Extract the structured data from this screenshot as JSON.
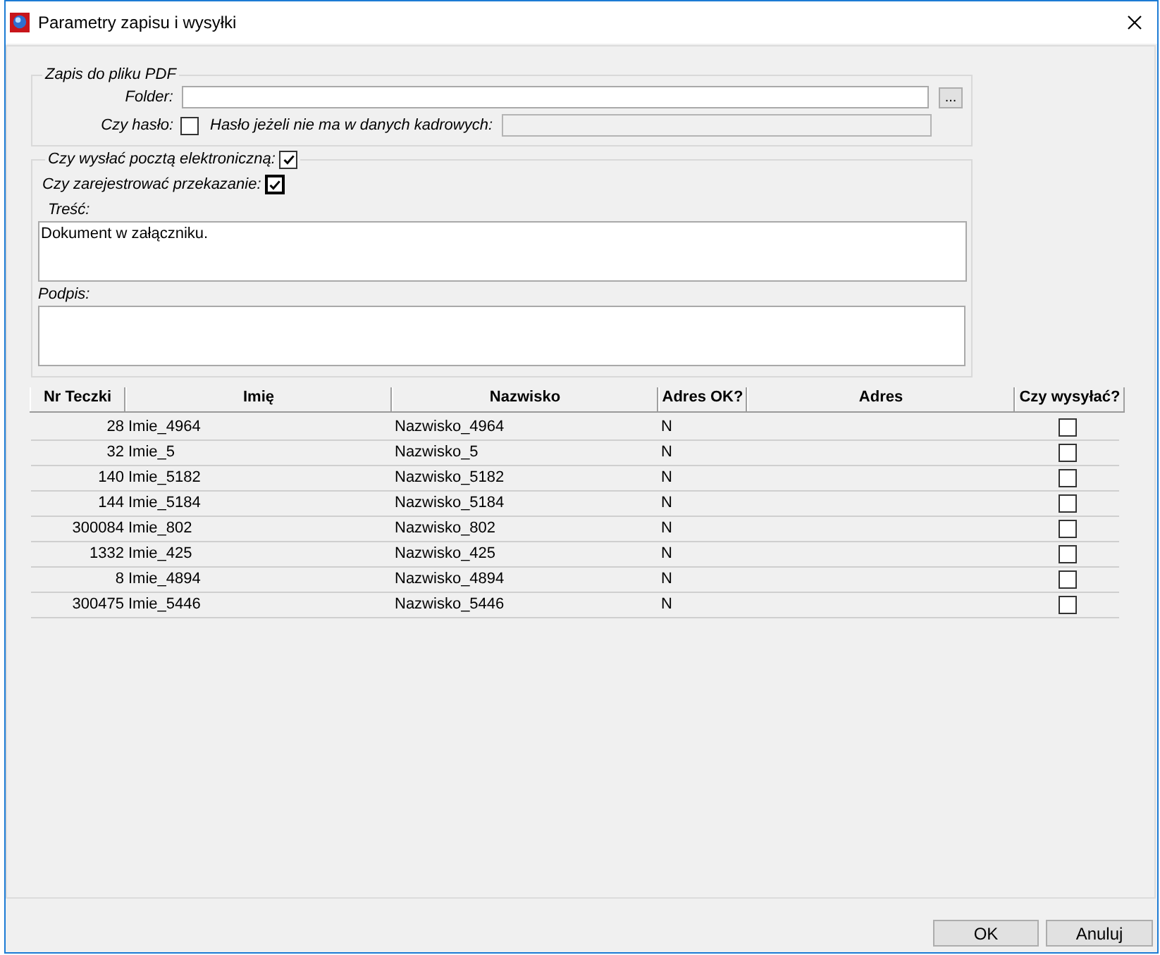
{
  "window": {
    "title": "Parametry zapisu i wysyłki"
  },
  "pdf_group": {
    "legend": "Zapis do pliku PDF",
    "folder": {
      "label": "Folder:"
    },
    "browse_button": "...",
    "password": {
      "label": "Czy hasło:",
      "checked": false
    },
    "fallback_password": {
      "label": "Hasło jeżeli nie ma w danych kadrowych:",
      "disabled": true
    }
  },
  "email_group": {
    "send_email": {
      "label": "Czy wysłać pocztą elektroniczną:",
      "checked": true
    },
    "register": {
      "label": "Czy zarejestrować przekazanie:",
      "checked": true,
      "focused": true
    },
    "body": {
      "label": "Treść:",
      "value": "Dokument w załączniku."
    },
    "signature": {
      "label": "Podpis:"
    }
  },
  "table": {
    "columns": [
      "Nr Teczki",
      "Imię",
      "Nazwisko",
      "Adres OK?",
      "Adres",
      "Czy wysyłać?"
    ],
    "rows": [
      {
        "nr": "28",
        "first_name": "Imie_4964",
        "last_name": "Nazwisko_4964",
        "address_ok": "N",
        "send": false
      },
      {
        "nr": "32",
        "first_name": "Imie_5",
        "last_name": "Nazwisko_5",
        "address_ok": "N",
        "send": false
      },
      {
        "nr": "140",
        "first_name": "Imie_5182",
        "last_name": "Nazwisko_5182",
        "address_ok": "N",
        "send": false
      },
      {
        "nr": "144",
        "first_name": "Imie_5184",
        "last_name": "Nazwisko_5184",
        "address_ok": "N",
        "send": false
      },
      {
        "nr": "300084",
        "first_name": "Imie_802",
        "last_name": "Nazwisko_802",
        "address_ok": "N",
        "send": false
      },
      {
        "nr": "1332",
        "first_name": "Imie_425",
        "last_name": "Nazwisko_425",
        "address_ok": "N",
        "send": false
      },
      {
        "nr": "8",
        "first_name": "Imie_4894",
        "last_name": "Nazwisko_4894",
        "address_ok": "N",
        "send": false
      },
      {
        "nr": "300475",
        "first_name": "Imie_5446",
        "last_name": "Nazwisko_5446",
        "address_ok": "N",
        "send": false
      }
    ]
  },
  "buttons": [
    {
      "label": "OK"
    },
    {
      "label": "Anuluj"
    }
  ]
}
